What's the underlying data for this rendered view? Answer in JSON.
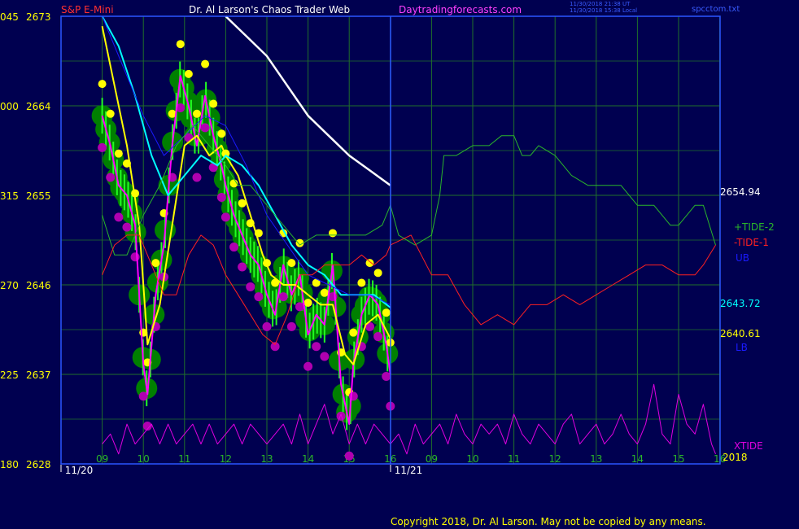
{
  "header": {
    "symbol": "S&P E-Mini",
    "title": "Dr. Al Larson's Chaos Trader Web",
    "website": "Daytradingforecasts.com",
    "timestamp_utc": "11/30/2018 21:38 UT",
    "timestamp_local": "11/30/2018 15:38 Local",
    "filename": "spcctom.txt"
  },
  "copyright": "Copyright 2018, Dr. Al Larson. May not be copied by any means.",
  "colors": {
    "background": "#000050",
    "grid": "#1f6f2a",
    "border": "#2a56ff",
    "price": "#ff00ff",
    "yellow": "#ffff00",
    "cyan": "#00ffff",
    "white": "#ffffff",
    "green": "#2ab52a",
    "red": "#ff2020",
    "blue": "#1a1aff",
    "ball_green": "#008000",
    "ball_yellow": "#ffff00",
    "ball_magenta": "#b000b0",
    "xtide": "#e000e0"
  },
  "chart_data": {
    "type": "line",
    "title": "S&P E-Mini",
    "ylim": [
      2628,
      2673
    ],
    "y_ticks": [
      {
        "left": "045",
        "value": 2673
      },
      {
        "left": "000",
        "value": 2664
      },
      {
        "left": "315",
        "value": 2655
      },
      {
        "left": "270",
        "value": 2646
      },
      {
        "left": "225",
        "value": 2637
      },
      {
        "left": "180",
        "value": 2628
      }
    ],
    "x_ticks": [
      "09",
      "10",
      "11",
      "12",
      "13",
      "14",
      "15",
      "16",
      "09",
      "10",
      "11",
      "12",
      "13",
      "14",
      "15",
      "16"
    ],
    "dates": [
      "11/20",
      "11/21"
    ],
    "year": "2018",
    "right_labels": [
      {
        "text": "2654.94",
        "color": "#ffffff",
        "value": 2654.94
      },
      {
        "text": "+TIDE-2",
        "color": "#2ab52a"
      },
      {
        "text": "-TIDE-1",
        "color": "#ff2020"
      },
      {
        "text": "UB",
        "color": "#1a1aff"
      },
      {
        "text": "2643.72",
        "color": "#00ffff",
        "value": 2643.72
      },
      {
        "text": "2640.61",
        "color": "#ffff00",
        "value": 2640.61
      },
      {
        "text": "LB",
        "color": "#1a1aff"
      },
      {
        "text": "XTIDE",
        "color": "#e000e0"
      }
    ],
    "series": [
      {
        "name": "price",
        "key": "price",
        "x": [
          9.0,
          9.2,
          9.4,
          9.6,
          9.8,
          10.0,
          10.1,
          10.3,
          10.5,
          10.7,
          10.9,
          11.1,
          11.3,
          11.5,
          11.7,
          11.9,
          12.0,
          12.2,
          12.4,
          12.6,
          12.8,
          13.0,
          13.2,
          13.4,
          13.6,
          13.8,
          14.0,
          14.2,
          14.4,
          14.6,
          14.8,
          15.0,
          15.1,
          15.3,
          15.5,
          15.7,
          15.9,
          16.0
        ],
        "y": [
          2663,
          2660,
          2656,
          2655,
          2652,
          2638,
          2635,
          2645,
          2650,
          2660,
          2667,
          2664,
          2660,
          2665,
          2661,
          2658,
          2656,
          2653,
          2651,
          2649,
          2648,
          2645,
          2643,
          2648,
          2645,
          2647,
          2641,
          2643,
          2642,
          2648,
          2636,
          2632,
          2638,
          2643,
          2645,
          2644,
          2640,
          2637
        ]
      },
      {
        "name": "yellow",
        "key": "yellow",
        "x": [
          9.0,
          9.3,
          9.6,
          9.9,
          10.1,
          10.4,
          10.7,
          11.0,
          11.3,
          11.6,
          11.9,
          12.0,
          12.3,
          12.6,
          12.9,
          13.1,
          13.4,
          13.7,
          14.0,
          14.3,
          14.6,
          14.9,
          15.1,
          15.4,
          15.7,
          16.0
        ],
        "y": [
          2672,
          2666,
          2660,
          2652,
          2640,
          2644,
          2652,
          2660,
          2661,
          2659,
          2660,
          2659,
          2657,
          2653,
          2649,
          2647,
          2646,
          2646,
          2645,
          2644,
          2644,
          2639,
          2638,
          2642,
          2643,
          2640.61
        ]
      },
      {
        "name": "cyan",
        "key": "cyan",
        "x": [
          9.0,
          9.4,
          9.8,
          10.2,
          10.6,
          11.0,
          11.4,
          11.8,
          12.0,
          12.4,
          12.8,
          13.2,
          13.6,
          14.0,
          14.4,
          14.8,
          15.2,
          15.6,
          16.0
        ],
        "y": [
          2673,
          2670,
          2665,
          2659,
          2655,
          2657,
          2659,
          2658,
          2659,
          2658,
          2656,
          2653,
          2650,
          2648,
          2647,
          2645,
          2645,
          2645,
          2643.72
        ]
      },
      {
        "name": "white",
        "key": "white",
        "x": [
          12.0,
          12.5,
          13.0,
          13.5,
          14.0,
          14.5,
          15.0,
          15.5,
          16.0
        ],
        "y": [
          2673,
          2671,
          2669,
          2666,
          2663,
          2661,
          2659,
          2657.5,
          2656
        ]
      },
      {
        "name": "UB",
        "key": "blue",
        "x": [
          9.0,
          9.5,
          10.0,
          10.5,
          11.0,
          11.5,
          12.0,
          12.5,
          13.0,
          13.5,
          14.0,
          14.5,
          15.0,
          15.5,
          16.0
        ],
        "y": [
          2673,
          2668,
          2663,
          2659,
          2661,
          2663,
          2662,
          2658,
          2653,
          2650,
          2647,
          2646,
          2645,
          2645,
          2644
        ]
      },
      {
        "name": "+TIDE-2",
        "key": "green",
        "x": [
          9.0,
          9.3,
          9.6,
          10.0,
          10.4,
          10.8,
          11.2,
          11.6,
          12.0,
          12.3,
          12.6,
          13.0,
          13.4,
          13.8,
          14.2,
          14.6,
          15.0,
          15.4,
          15.8,
          16.0,
          16.2,
          16.6,
          17.0,
          17.2,
          17.3,
          17.6,
          18.0,
          18.4,
          18.7,
          19.0,
          19.2,
          19.4,
          19.6,
          20.0,
          20.4,
          20.8,
          21.2,
          21.6,
          22.0,
          22.4,
          22.8,
          23.0,
          23.4,
          23.6,
          23.9
        ],
        "y": [
          2653,
          2649,
          2649,
          2653,
          2656,
          2660,
          2662,
          2660,
          2658,
          2656,
          2656,
          2654,
          2652,
          2650,
          2651,
          2651,
          2651,
          2651,
          2652,
          2654,
          2651,
          2650,
          2651,
          2655,
          2659,
          2659,
          2660,
          2660,
          2661,
          2661,
          2659,
          2659,
          2660,
          2659,
          2657,
          2656,
          2656,
          2656,
          2654,
          2654,
          2652,
          2652,
          2654,
          2654,
          2650
        ]
      },
      {
        "name": "-TIDE-1",
        "key": "red",
        "x": [
          9.0,
          9.3,
          9.6,
          9.9,
          10.2,
          10.5,
          10.8,
          11.1,
          11.4,
          11.7,
          12.0,
          12.3,
          12.6,
          12.9,
          13.2,
          13.5,
          13.8,
          14.1,
          14.4,
          14.7,
          15.0,
          15.3,
          15.6,
          15.9,
          16.0,
          16.5,
          17.0,
          17.4,
          17.8,
          18.2,
          18.6,
          19.0,
          19.4,
          19.8,
          20.2,
          20.6,
          21.0,
          21.4,
          21.8,
          22.2,
          22.6,
          23.0,
          23.4,
          23.6,
          23.9
        ],
        "y": [
          2647,
          2650,
          2651,
          2651,
          2648,
          2645,
          2645,
          2649,
          2651,
          2650,
          2647,
          2645,
          2643,
          2641,
          2640,
          2643,
          2647,
          2647,
          2648,
          2648,
          2648,
          2649,
          2648,
          2649,
          2650,
          2651,
          2647,
          2647,
          2644,
          2642,
          2643,
          2642,
          2644,
          2644,
          2645,
          2644,
          2645,
          2646,
          2647,
          2648,
          2648,
          2647,
          2647,
          2648,
          2650
        ]
      },
      {
        "name": "XTIDE",
        "key": "xtide",
        "x": [
          9.0,
          9.2,
          9.4,
          9.6,
          9.8,
          10.0,
          10.2,
          10.4,
          10.6,
          10.8,
          11.0,
          11.2,
          11.4,
          11.6,
          11.8,
          12.0,
          12.2,
          12.4,
          12.6,
          12.8,
          13.0,
          13.2,
          13.4,
          13.6,
          13.8,
          14.0,
          14.2,
          14.4,
          14.6,
          14.8,
          15.0,
          15.2,
          15.4,
          15.6,
          15.8,
          16.0,
          16.2,
          16.4,
          16.6,
          16.8,
          17.0,
          17.2,
          17.4,
          17.6,
          17.8,
          18.0,
          18.2,
          18.4,
          18.6,
          18.8,
          19.0,
          19.2,
          19.4,
          19.6,
          19.8,
          20.0,
          20.2,
          20.4,
          20.6,
          20.8,
          21.0,
          21.2,
          21.4,
          21.6,
          21.8,
          22.0,
          22.2,
          22.4,
          22.6,
          22.8,
          23.0,
          23.2,
          23.4,
          23.6,
          23.8,
          23.9
        ],
        "y": [
          2630,
          2631,
          2629,
          2632,
          2630,
          2631,
          2632,
          2630,
          2632,
          2630,
          2631,
          2632,
          2630,
          2632,
          2630,
          2631,
          2632,
          2630,
          2632,
          2631,
          2630,
          2631,
          2632,
          2630,
          2633,
          2630,
          2632,
          2634,
          2631,
          2633,
          2630,
          2632,
          2630,
          2632,
          2631,
          2630,
          2631,
          2629,
          2632,
          2630,
          2631,
          2632,
          2630,
          2633,
          2631,
          2630,
          2632,
          2631,
          2632,
          2630,
          2633,
          2631,
          2630,
          2632,
          2631,
          2630,
          2632,
          2633,
          2630,
          2631,
          2632,
          2630,
          2631,
          2633,
          2631,
          2630,
          2632,
          2636,
          2631,
          2630,
          2635,
          2632,
          2631,
          2634,
          2630,
          2629
        ]
      }
    ]
  }
}
